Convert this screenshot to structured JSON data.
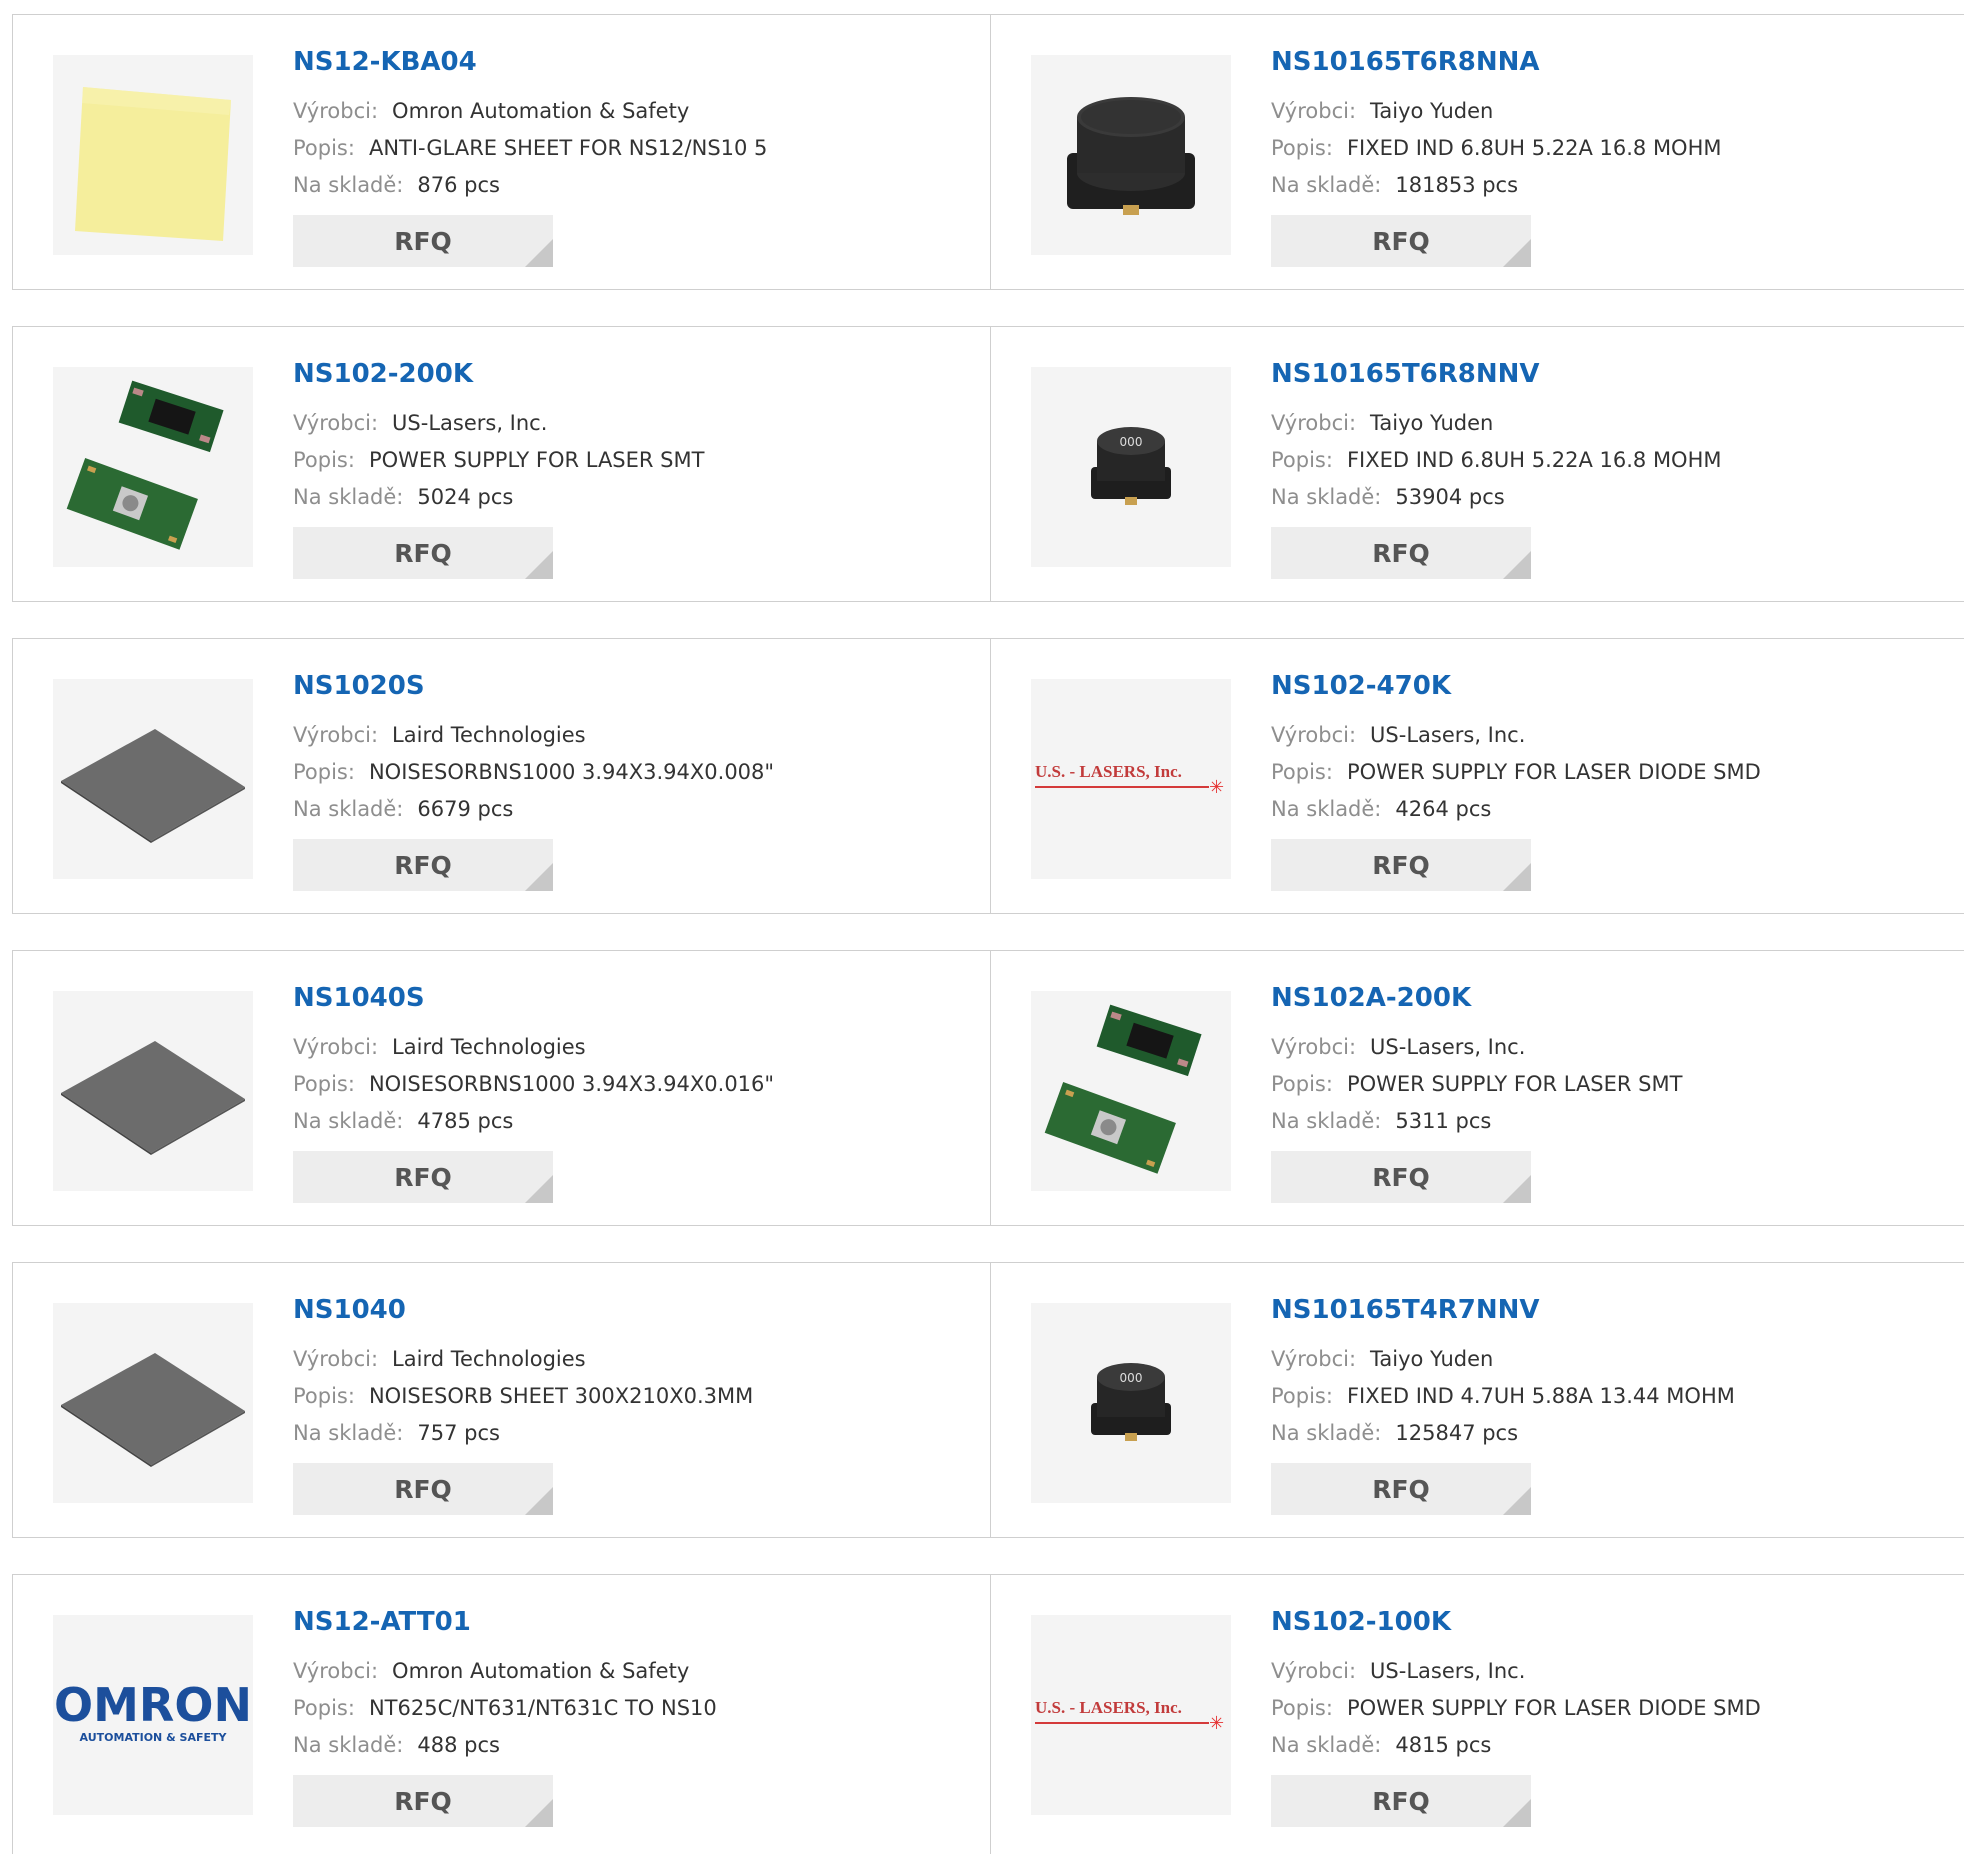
{
  "labels": {
    "manufacturer": "Výrobci:",
    "description": "Popis:",
    "stock": "Na skladě:",
    "rfq": "RFQ"
  },
  "colors": {
    "part_number_link": "#1565b3",
    "label_gray": "#8e8e8e",
    "button_bg": "#ededed",
    "border": "#cfcfcf"
  },
  "rows": [
    [
      {
        "pn": "NS12-KBA04",
        "mfr": "Omron Automation & Safety",
        "desc": "ANTI-GLARE SHEET FOR NS12/NS10 5",
        "stock": "876 pcs",
        "img": "yellow-sheet-image"
      },
      {
        "pn": "NS10165T6R8NNA",
        "mfr": "Taiyo Yuden",
        "desc": "FIXED IND 6.8UH 5.22A 16.8 MOHM",
        "stock": "181853 pcs",
        "img": "large-inductor-image"
      }
    ],
    [
      {
        "pn": "NS102-200K",
        "mfr": "US-Lasers, Inc.",
        "desc": "POWER SUPPLY FOR LASER SMT",
        "stock": "5024 pcs",
        "img": "pcb-modules-image"
      },
      {
        "pn": "NS10165T6R8NNV",
        "mfr": "Taiyo Yuden",
        "desc": "FIXED IND 6.8UH 5.22A 16.8 MOHM",
        "stock": "53904 pcs",
        "img": "small-inductor-image"
      }
    ],
    [
      {
        "pn": "NS1020S",
        "mfr": "Laird Technologies",
        "desc": "NOISESORBNS1000 3.94X3.94X0.008\"",
        "stock": "6679 pcs",
        "img": "gray-sheet-image"
      },
      {
        "pn": "NS102-470K",
        "mfr": "US-Lasers, Inc.",
        "desc": "POWER SUPPLY FOR LASER DIODE SMD",
        "stock": "4264 pcs",
        "img": "us-lasers-logo",
        "logo_text": "U.S. - LASERS, Inc."
      }
    ],
    [
      {
        "pn": "NS1040S",
        "mfr": "Laird Technologies",
        "desc": "NOISESORBNS1000 3.94X3.94X0.016\"",
        "stock": "4785 pcs",
        "img": "gray-sheet-image"
      },
      {
        "pn": "NS102A-200K",
        "mfr": "US-Lasers, Inc.",
        "desc": "POWER SUPPLY FOR LASER SMT",
        "stock": "5311 pcs",
        "img": "pcb-modules-image"
      }
    ],
    [
      {
        "pn": "NS1040",
        "mfr": "Laird Technologies",
        "desc": "NOISESORB SHEET 300X210X0.3MM",
        "stock": "757 pcs",
        "img": "gray-sheet-image"
      },
      {
        "pn": "NS10165T4R7NNV",
        "mfr": "Taiyo Yuden",
        "desc": "FIXED IND 4.7UH 5.88A 13.44 MOHM",
        "stock": "125847 pcs",
        "img": "small-inductor-image"
      }
    ],
    [
      {
        "pn": "NS12-ATT01",
        "mfr": "Omron Automation & Safety",
        "desc": "NT625C/NT631/NT631C TO NS10",
        "stock": "488 pcs",
        "img": "omron-logo",
        "logo_text": "OMRON",
        "logo_sub": "AUTOMATION & SAFETY"
      },
      {
        "pn": "NS102-100K",
        "mfr": "US-Lasers, Inc.",
        "desc": "POWER SUPPLY FOR LASER DIODE SMD",
        "stock": "4815 pcs",
        "img": "us-lasers-logo",
        "logo_text": "U.S. - LASERS, Inc."
      }
    ]
  ]
}
